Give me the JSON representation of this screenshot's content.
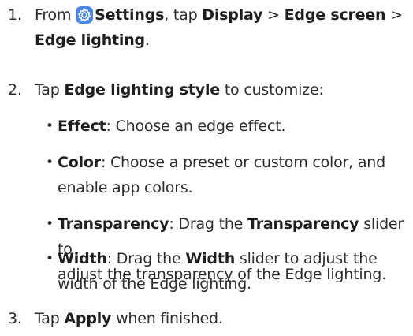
{
  "step1": {
    "number": "1.",
    "from": "From",
    "settings": "Settings",
    "tap": ", tap",
    "display": "Display",
    "sep1": ">",
    "edge_screen": "Edge screen",
    "sep2": ">",
    "edge_lighting": "Edge lighting",
    "end": ".",
    "icon": "settings-gear-icon"
  },
  "step2": {
    "number": "2.",
    "tap": "Tap",
    "edge_lighting_style": "Edge lighting style",
    "to_customize": "to customize:"
  },
  "bullets": [
    {
      "dot": "•",
      "term": "Effect",
      "text": ": Choose an edge effect."
    },
    {
      "dot": "•",
      "term": "Color",
      "text_line1": ": Choose a preset or custom color, and",
      "text_line2": "enable app colors."
    },
    {
      "dot": "•",
      "term": "Transparency",
      "text1": ": Drag the",
      "term2": "Transparency",
      "text2": "slider to",
      "text_line2": "adjust the transparency of the Edge lighting."
    },
    {
      "dot": "•",
      "term": "Width",
      "text1": ": Drag the",
      "term2": "Width",
      "text2": "slider to adjust the",
      "text_line2": "width of the Edge lighting."
    }
  ],
  "step3": {
    "number": "3.",
    "tap": "Tap",
    "apply": "Apply",
    "end": "when finished."
  }
}
